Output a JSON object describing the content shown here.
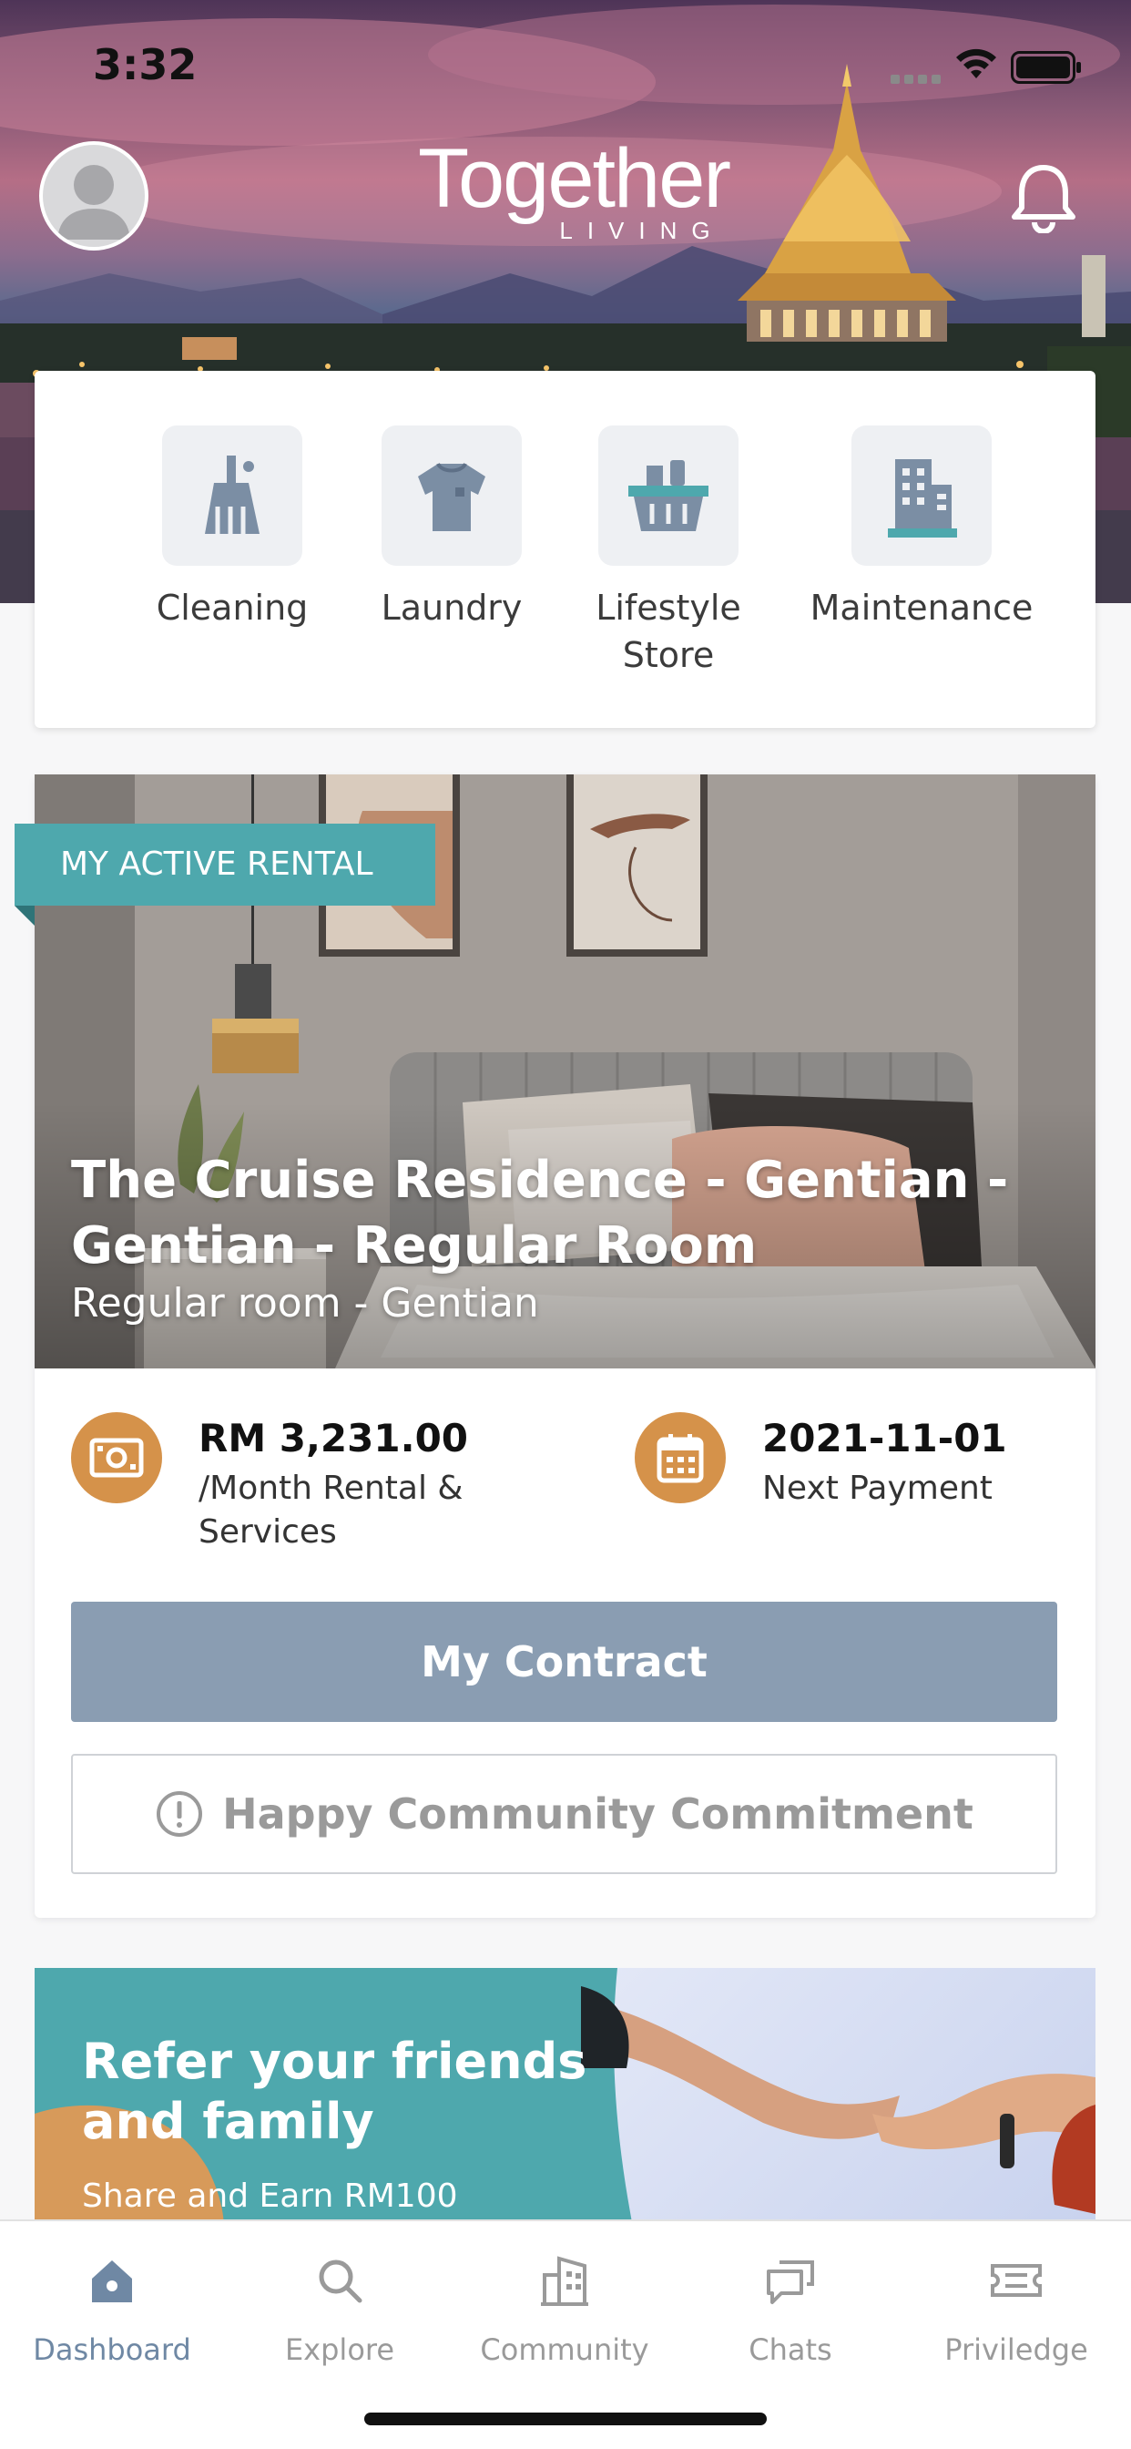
{
  "status_bar": {
    "time": "3:32"
  },
  "header": {
    "logo_main": "Together",
    "logo_sub": "LIVING",
    "avatar_icon": "user-avatar-icon",
    "notification_icon": "bell-icon"
  },
  "services": [
    {
      "label": "Cleaning",
      "icon": "broom-icon"
    },
    {
      "label": "Laundry",
      "icon": "tshirt-icon"
    },
    {
      "label": "Lifestyle Store",
      "icon": "basket-icon"
    },
    {
      "label": "Maintenance",
      "icon": "building-icon"
    }
  ],
  "rental": {
    "badge": "MY ACTIVE RENTAL",
    "title": "The Cruise Residence - Gentian - Gentian - Regular Room",
    "subtitle": "Regular room - Gentian",
    "price_value": "RM 3,231.00",
    "price_label": "/Month Rental & Services",
    "payment_value": "2021-11-01",
    "payment_label": "Next Payment",
    "contract_button": "My Contract",
    "commitment_button": "Happy Community Commitment"
  },
  "referral": {
    "title": "Refer your friends and family",
    "subtitle": "Share and Earn RM100"
  },
  "tabs": [
    {
      "label": "Dashboard",
      "icon": "home-icon",
      "active": true
    },
    {
      "label": "Explore",
      "icon": "search-icon",
      "active": false
    },
    {
      "label": "Community",
      "icon": "community-building-icon",
      "active": false
    },
    {
      "label": "Chats",
      "icon": "chat-icon",
      "active": false
    },
    {
      "label": "Priviledge",
      "icon": "ticket-icon",
      "active": false
    }
  ],
  "colors": {
    "accent_teal": "#4ea8ad",
    "icon_orange": "#d5924a",
    "button_blue_gray": "#8a9db2",
    "active_tab": "#6f88a4"
  }
}
